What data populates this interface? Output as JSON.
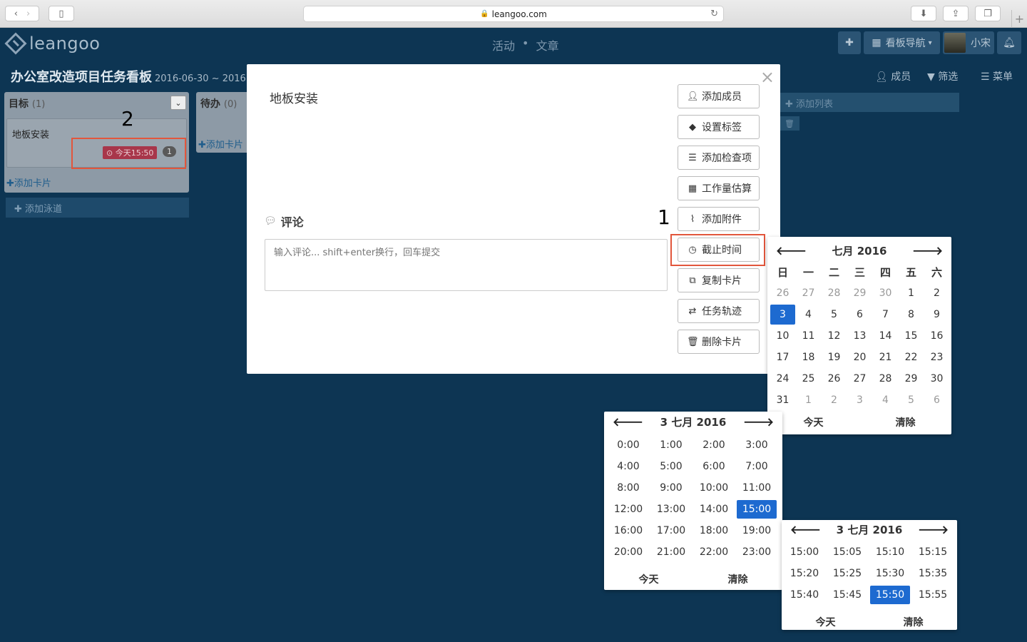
{
  "browser": {
    "url": "leangoo.com"
  },
  "header": {
    "logo_text": "leangoo",
    "nav_activity": "活动",
    "nav_separator": "•",
    "nav_articles": "文章",
    "board_nav_label": "看板导航",
    "username": "小宋"
  },
  "board": {
    "title": "办公室改造项目任务看板",
    "date_range": "2016-06-30 ~ 2016",
    "members_label": "成员",
    "filter_label": "筛选",
    "menu_label": "菜单",
    "add_list_label": "添加列表",
    "add_lane_label": "添加泳道",
    "columns": [
      {
        "name": "目标",
        "count": "(1)",
        "add_card": "添加卡片"
      },
      {
        "name": "待办",
        "count": "(0)",
        "add_card": "添加卡片"
      }
    ],
    "card": {
      "title": "地板安装",
      "due": "今天15:50",
      "comment_count": "1"
    }
  },
  "annotations": {
    "step1": "1",
    "step2": "2"
  },
  "modal": {
    "card_title": "地板安装",
    "comment_heading": "评论",
    "comment_placeholder": "输入评论... shift+enter换行，回车提交",
    "buttons": {
      "add_member": "添加成员",
      "set_label": "设置标签",
      "add_checklist": "添加检查项",
      "estimate": "工作量估算",
      "add_attachment": "添加附件",
      "due_time": "截止时间",
      "copy_card": "复制卡片",
      "task_track": "任务轨迹",
      "delete_card": "删除卡片"
    }
  },
  "date_picker": {
    "title": "七月 2016",
    "weekdays": [
      "日",
      "一",
      "二",
      "三",
      "四",
      "五",
      "六"
    ],
    "days": [
      "26",
      "27",
      "28",
      "29",
      "30",
      "1",
      "2",
      "3",
      "4",
      "5",
      "6",
      "7",
      "8",
      "9",
      "10",
      "11",
      "12",
      "13",
      "14",
      "15",
      "16",
      "17",
      "18",
      "19",
      "20",
      "21",
      "22",
      "23",
      "24",
      "25",
      "26",
      "27",
      "28",
      "29",
      "30",
      "31",
      "1",
      "2",
      "3",
      "4",
      "5",
      "6"
    ],
    "muted_indices": [
      0,
      1,
      2,
      3,
      4,
      36,
      37,
      38,
      39,
      40,
      41
    ],
    "selected_index": 7,
    "today_label": "今天",
    "clear_label": "清除"
  },
  "hour_picker": {
    "title": "3 七月 2016",
    "hours": [
      "0:00",
      "1:00",
      "2:00",
      "3:00",
      "4:00",
      "5:00",
      "6:00",
      "7:00",
      "8:00",
      "9:00",
      "10:00",
      "11:00",
      "12:00",
      "13:00",
      "14:00",
      "15:00",
      "16:00",
      "17:00",
      "18:00",
      "19:00",
      "20:00",
      "21:00",
      "22:00",
      "23:00"
    ],
    "selected_index": 15,
    "today_label": "今天",
    "clear_label": "清除"
  },
  "minute_picker": {
    "title": "3 七月 2016",
    "minutes": [
      "15:00",
      "15:05",
      "15:10",
      "15:15",
      "15:20",
      "15:25",
      "15:30",
      "15:35",
      "15:40",
      "15:45",
      "15:50",
      "15:55"
    ],
    "selected_index": 10,
    "today_label": "今天",
    "clear_label": "清除"
  },
  "colors": {
    "board_bg": "#0d3553",
    "selected": "#1d6ad0",
    "due_badge": "#a8364a",
    "highlight": "#e2563c"
  }
}
